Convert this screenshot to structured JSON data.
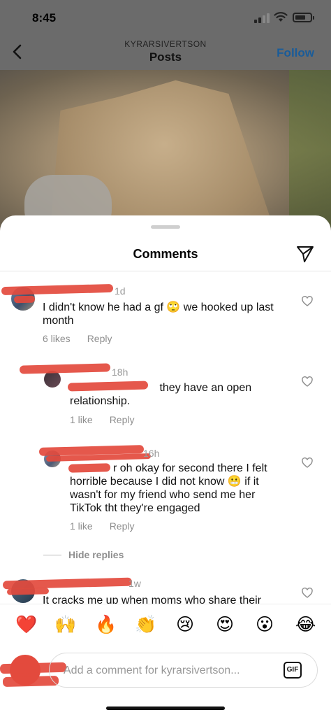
{
  "status_bar": {
    "time": "8:45"
  },
  "nav": {
    "username": "KYRARSIVERTSON",
    "title": "Posts",
    "follow_label": "Follow"
  },
  "sheet": {
    "title": "Comments"
  },
  "comments": [
    {
      "time": "1d",
      "text": "I didn't know he had a gf 🙄 we hooked up last month",
      "likes": "6 likes",
      "reply_label": "Reply"
    },
    {
      "time": "18h",
      "text": "they have an open relationship.",
      "likes": "1 like",
      "reply_label": "Reply"
    },
    {
      "time": "16h",
      "mention_tail": "r",
      "text": "oh okay for second there I felt horrible because I did not know 😬 if it wasn't for my friend who send me her TikTok tht they're engaged",
      "likes": "1 like",
      "reply_label": "Reply"
    },
    {
      "time": "1w",
      "text": "It cracks me up when moms who share their"
    }
  ],
  "hide_replies_label": "Hide replies",
  "emojis": [
    "❤️",
    "🙌",
    "🔥",
    "👏",
    "😢",
    "😍",
    "😮",
    "😂"
  ],
  "composer": {
    "placeholder": "Add a comment for kyrarsivertson...",
    "gif_label": "GIF"
  }
}
